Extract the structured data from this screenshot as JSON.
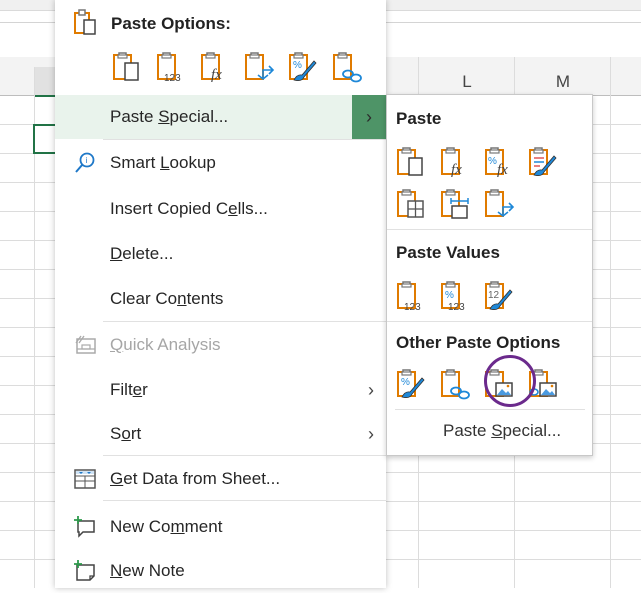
{
  "spreadsheet": {
    "columns": [
      "L",
      "M"
    ],
    "selection_color": "#217346"
  },
  "context_menu": {
    "paste_options": {
      "title": "Paste Options:",
      "icons": [
        "paste-icon",
        "paste-values-icon",
        "paste-formulas-icon",
        "paste-transpose-icon",
        "paste-formatting-icon",
        "paste-link-icon"
      ]
    },
    "items": [
      {
        "label_parts": [
          "Paste ",
          "S",
          "pecial..."
        ],
        "has_submenu": true,
        "active": true
      },
      {
        "label_parts": [
          "Smart ",
          "L",
          "ookup"
        ],
        "icon": "smart-lookup-icon"
      },
      {
        "label_parts": [
          "Insert Copied C",
          "e",
          "lls..."
        ]
      },
      {
        "label_parts": [
          "",
          "D",
          "elete..."
        ]
      },
      {
        "label_parts": [
          "Clear Co",
          "n",
          "tents"
        ]
      },
      {
        "label_parts": [
          "",
          "Q",
          "uick Analysis"
        ],
        "icon": "quick-analysis-icon",
        "disabled": true
      },
      {
        "label_parts": [
          "Filt",
          "e",
          "r"
        ],
        "has_submenu": true
      },
      {
        "label_parts": [
          "S",
          "o",
          "rt"
        ],
        "has_submenu": true
      },
      {
        "label_parts": [
          "",
          "G",
          "et Data from Sheet..."
        ],
        "icon": "get-data-icon"
      },
      {
        "label_parts": [
          "New Co",
          "m",
          "ment"
        ],
        "icon": "new-comment-icon"
      },
      {
        "label_parts": [
          "",
          "N",
          "ew Note"
        ],
        "icon": "new-note-icon"
      }
    ],
    "active_color": "#4e9467"
  },
  "submenu": {
    "paste": {
      "title": "Paste",
      "icons": [
        "paste-icon",
        "paste-formulas-icon",
        "paste-formulas-number-formatting-icon",
        "paste-keep-source-formatting-icon",
        "paste-no-borders-icon",
        "paste-keep-column-widths-icon",
        "paste-transpose-icon"
      ]
    },
    "paste_values": {
      "title": "Paste Values",
      "icons": [
        "paste-values-icon",
        "paste-values-number-formatting-icon",
        "paste-values-source-formatting-icon"
      ]
    },
    "other": {
      "title": "Other Paste Options",
      "icons": [
        "paste-formatting-icon",
        "paste-link-icon",
        "paste-picture-icon",
        "paste-linked-picture-icon"
      ]
    },
    "footer": [
      "Paste ",
      "S",
      "pecial..."
    ],
    "highlight_color": "#6b2a8c"
  }
}
